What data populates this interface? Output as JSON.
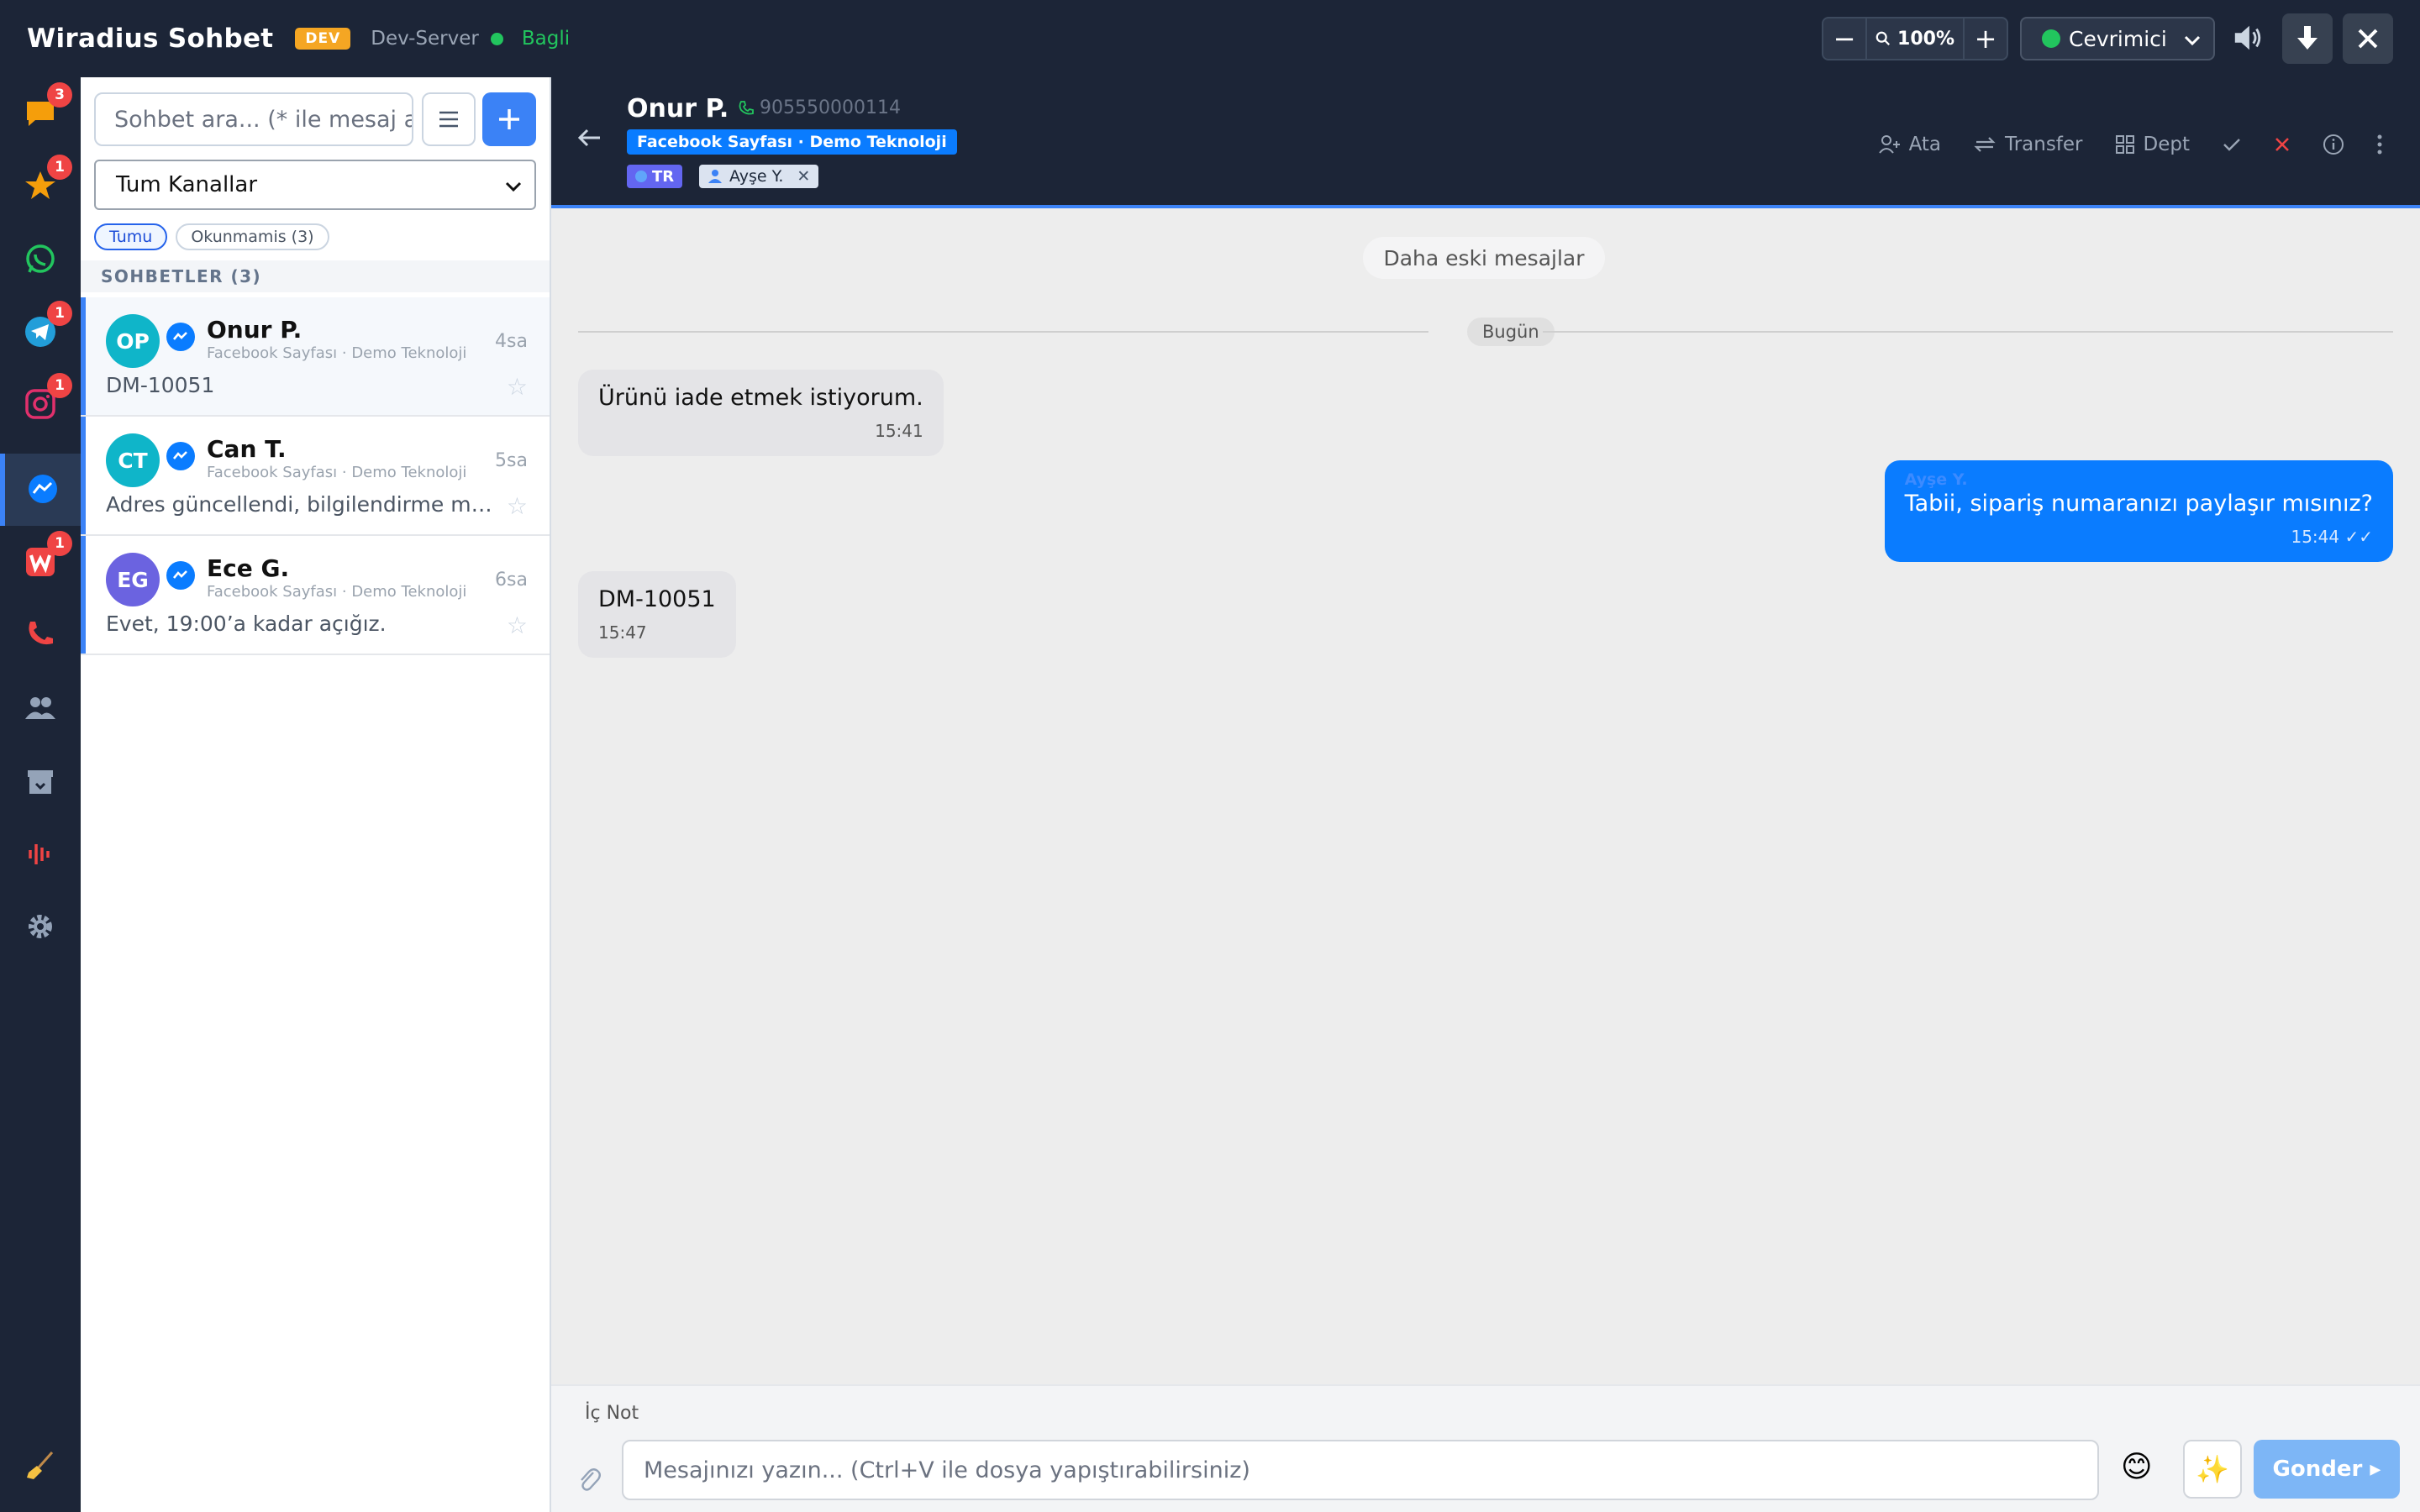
{
  "app": {
    "title": "Wiradius Sohbet",
    "env_badge": "DEV",
    "server": "Dev-Server",
    "connection": "Bagli"
  },
  "toolbar": {
    "zoom_minus": "−",
    "zoom_value": "100%",
    "zoom_plus": "+",
    "status": "Cevrimici"
  },
  "rail": {
    "badges": {
      "all": "3",
      "starred": "1",
      "telegram": "1",
      "instagram": "1",
      "wiradius": "1"
    }
  },
  "list": {
    "search_placeholder": "Sohbet ara... (* ile mesaj ara)",
    "channel_filter": "Tum Kanallar",
    "filters": [
      "Tumu",
      "Okunmamis (3)"
    ],
    "section_title": "SOHBETLER (3)",
    "conversations": [
      {
        "initials": "OP",
        "name": "Onur P.",
        "source": "Facebook Sayfası · Demo Teknoloji",
        "time": "4sa",
        "preview": "DM-10051",
        "color": "#0fb5c9"
      },
      {
        "initials": "CT",
        "name": "Can T.",
        "source": "Facebook Sayfası · Demo Teknoloji",
        "time": "5sa",
        "preview": "Adres güncellendi, bilgilendirme mesajı gönderildi.",
        "color": "#0fb5c9"
      },
      {
        "initials": "EG",
        "name": "Ece G.",
        "source": "Facebook Sayfası · Demo Teknoloji",
        "time": "6sa",
        "preview": "Evet, 19:00’a kadar açığız.",
        "color": "#6b63e0"
      }
    ]
  },
  "chat_header": {
    "name": "Onur P.",
    "phone": "905550000114",
    "channel_tag": "Facebook Sayfası · Demo Teknoloji",
    "language": "TR",
    "agent": "Ayşe Y.",
    "actions": {
      "assign": "Ata",
      "transfer": "Transfer",
      "dept": "Dept"
    }
  },
  "chat": {
    "older_messages": "Daha eski mesajlar",
    "date_divider": "Bugün",
    "messages": [
      {
        "dir": "in",
        "text": "Ürünü iade etmek istiyorum.",
        "time": "15:41"
      },
      {
        "dir": "out",
        "author": "Ayşe Y.",
        "text": "Tabii, sipariş numaranızı paylaşır mısınız?",
        "time": "15:44 ✓✓"
      },
      {
        "dir": "in",
        "text": "DM-10051",
        "time": "15:47"
      }
    ]
  },
  "composer": {
    "note_label": "İç Not",
    "placeholder": "Mesajınızı yazın... (Ctrl+V ile dosya yapıştırabilirsiniz)",
    "send_label": "Gonder ▸"
  },
  "colors": {
    "topbar": "#1c2537",
    "accent": "#3b82f6",
    "messenger": "#0a7cff",
    "online": "#22c55e",
    "badge": "#ef4444"
  }
}
